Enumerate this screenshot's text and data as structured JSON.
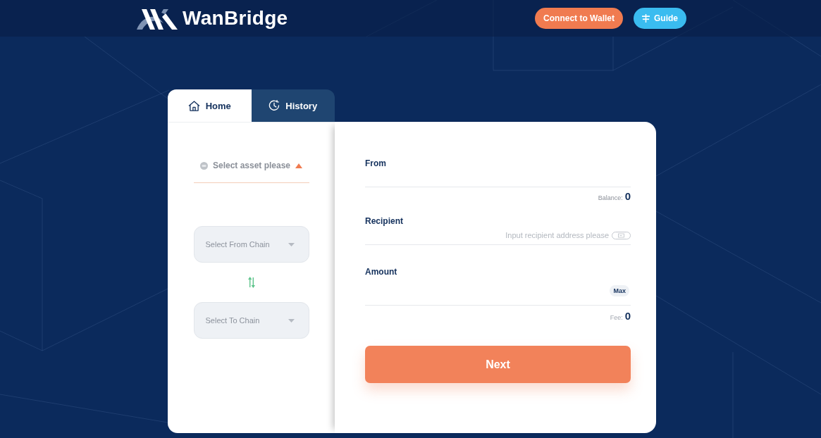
{
  "header": {
    "logo": "WanBridge",
    "buttons": [
      {
        "kind": "wallet",
        "label": "Connect to Wallet"
      },
      {
        "kind": "guide",
        "label": "Guide"
      }
    ]
  },
  "tabs": [
    {
      "label": "Home",
      "selected": true
    },
    {
      "label": "History",
      "selected": false
    }
  ],
  "asset_selector": {
    "label": "Select asset please"
  },
  "chain_selectors": [
    {
      "label": "Select From Chain"
    },
    {
      "label": "Select To Chain"
    }
  ],
  "form": {
    "fields": [
      {
        "kind": "select",
        "label": "From",
        "info": {
          "label": "Balance:",
          "value": "0"
        }
      },
      {
        "kind": "address",
        "label": "Recipient",
        "placeholder": "Input recipient address please"
      },
      {
        "kind": "amount",
        "label": "Amount",
        "action": "Max",
        "info": {
          "label": "Fee:",
          "value": "0"
        }
      }
    ],
    "submit": "Next"
  }
}
